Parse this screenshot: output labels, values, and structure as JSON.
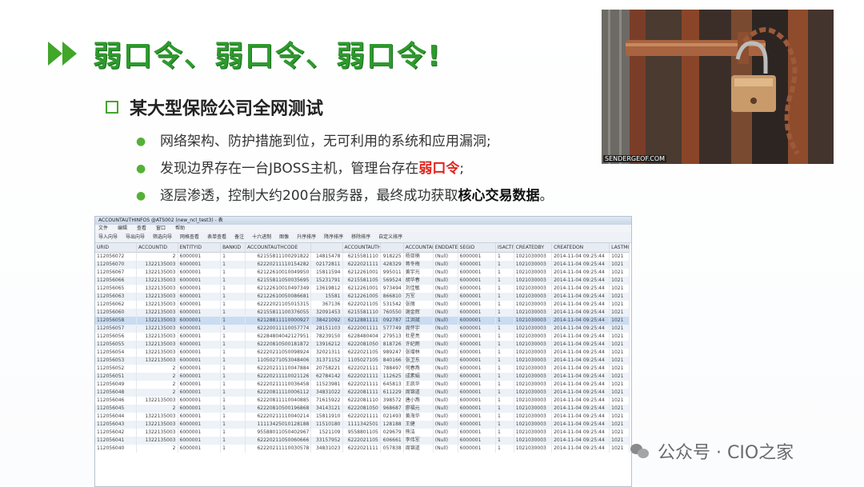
{
  "slide": {
    "title": "弱口令、弱口令、弱口令!",
    "subtitle": "某大型保险公司全网测试",
    "points": [
      {
        "text": "网络架构、防护措施到位，无可利用的系统和应用漏洞;"
      },
      {
        "prefix": "发现边界存在一台JBOSS主机，管理台存在",
        "highlight": "弱口令",
        "suffix": ";"
      },
      {
        "prefix": "逐层渗透，控制大约200台服务器，最终成功获取",
        "highlight": "核心交易数据",
        "suffix": "。"
      }
    ],
    "photo_credit": "SENDERGEOF.COM"
  },
  "db_window": {
    "title": "ACCOUNTAUTHINFOS @ATS002 (new_ncl_test3) - 表",
    "menu": [
      "文件",
      "编辑",
      "查看",
      "窗口",
      "帮助"
    ],
    "toolbar": [
      "导入向导",
      "导出向导",
      "筛选向导",
      "网格查看",
      "表单查看",
      "备注",
      "十六进制",
      "图像",
      "升序排序",
      "降序排序",
      "移除排序",
      "自定义排序"
    ],
    "columns": [
      "URID",
      "ACCOUNTID",
      "ENTITYID",
      "BANKID",
      "ACCOUNTAUTHCODE",
      "ACCOUNTAUTHNUMBER",
      "ACCOUNTAL",
      "ENDDATE",
      "SEGID",
      "ISACTIV",
      "CREATEDBY",
      "CREATEDON",
      "LASTMODIFIED"
    ],
    "rows": [
      [
        "112056072",
        "2",
        "6000001",
        "1",
        "62155811100291822",
        "14815478",
        "6215581110",
        "918225",
        "杨亚楠",
        "(Null)",
        "6000001",
        "1",
        "1021030003",
        "2014-11-04 09:25:44",
        "1021"
      ],
      [
        "112056070",
        "1322135003",
        "6000001",
        "1",
        "62220211110154282",
        "02172811",
        "6222021111",
        "428329",
        "蒋冬梅",
        "(Null)",
        "6000001",
        "1",
        "1021030003",
        "2014-11-04 09:25:44",
        "1021"
      ],
      [
        "112056067",
        "1322135003",
        "6000001",
        "1",
        "62122610010049950",
        "15811594",
        "6212261001",
        "995011",
        "黄宇光",
        "(Null)",
        "6000001",
        "1",
        "1021030003",
        "2014-11-04 09:25:44",
        "1021"
      ],
      [
        "112056066",
        "1322135003",
        "6000001",
        "1",
        "62155811050035695",
        "15231791",
        "6215581105",
        "569524",
        "胡华春",
        "(Null)",
        "6000001",
        "1",
        "1021030003",
        "2014-11-04 09:25:44",
        "1021"
      ],
      [
        "112056065",
        "1322135003",
        "6000001",
        "1",
        "62122610010497349",
        "13619812",
        "6212261001",
        "973494",
        "刘佳敏",
        "(Null)",
        "6000001",
        "1",
        "1021030003",
        "2014-11-04 09:25:44",
        "1021"
      ],
      [
        "112056063",
        "1322135003",
        "6000001",
        "1",
        "62122610050086681",
        "15581",
        "6212261005",
        "866810",
        "万军",
        "(Null)",
        "6000001",
        "1",
        "1021030003",
        "2014-11-04 09:25:44",
        "1021"
      ],
      [
        "112056062",
        "1322135003",
        "6000001",
        "1",
        "62222021105015315",
        "367136",
        "6222021105",
        "531542",
        "张丽",
        "(Null)",
        "6000001",
        "1",
        "1021030003",
        "2014-11-04 09:25:44",
        "1021"
      ],
      [
        "112056060",
        "1322135003",
        "6000001",
        "1",
        "62155811100376055",
        "32091453",
        "6215581110",
        "760550",
        "谢金辉",
        "(Null)",
        "6000001",
        "1",
        "1021030003",
        "2014-11-04 09:25:44",
        "1021"
      ],
      [
        "112056058",
        "1322135003",
        "6000001",
        "1",
        "62128811110000927",
        "38421092",
        "6212881111",
        "092787",
        "江洪斌",
        "(Null)",
        "6000001",
        "1",
        "1021030003",
        "2014-11-04 09:25:44",
        "1021"
      ],
      [
        "112056057",
        "1322135003",
        "6000001",
        "1",
        "62220011110057774",
        "28151103",
        "6222001111",
        "577749",
        "周怀宇",
        "(Null)",
        "6000001",
        "1",
        "1021030003",
        "2014-11-04 09:25:44",
        "1021"
      ],
      [
        "112056056",
        "1322135003",
        "6000001",
        "1",
        "62284804042127951",
        "78239150",
        "6228480404",
        "279513",
        "杜星亮",
        "(Null)",
        "6000001",
        "1",
        "1021030003",
        "2014-11-04 09:25:44",
        "1021"
      ],
      [
        "112056055",
        "1322135003",
        "6000001",
        "1",
        "62220810500181872",
        "13916212",
        "6222081050",
        "818726",
        "许纪雨",
        "(Null)",
        "6000001",
        "1",
        "1021030003",
        "2014-11-04 09:25:44",
        "1021"
      ],
      [
        "112056054",
        "1322135003",
        "6000001",
        "1",
        "62220211050098924",
        "32021311",
        "6222021105",
        "989247",
        "张增林",
        "(Null)",
        "6000001",
        "1",
        "1021030003",
        "2014-11-04 09:25:44",
        "1021"
      ],
      [
        "112056053",
        "1322135003",
        "6000001",
        "1",
        "11050271053048406",
        "31371152",
        "1105027105",
        "840166",
        "张卫东",
        "(Null)",
        "6000001",
        "1",
        "1021030003",
        "2014-11-04 09:25:44",
        "1021"
      ],
      [
        "112056052",
        "2",
        "6000001",
        "1",
        "62220211110047884",
        "20758221",
        "6222021111",
        "788497",
        "何春燕",
        "(Null)",
        "6000001",
        "1",
        "1021030003",
        "2014-11-04 09:25:44",
        "1021"
      ],
      [
        "112056051",
        "2",
        "6000001",
        "1",
        "62220211110021126",
        "62784142",
        "6222021111",
        "112625",
        "成素娟",
        "(Null)",
        "6000001",
        "1",
        "1021030003",
        "2014-11-04 09:25:44",
        "1021"
      ],
      [
        "112056049",
        "2",
        "6000001",
        "1",
        "62220211110036458",
        "11523981",
        "6222021111",
        "645813",
        "王凯华",
        "(Null)",
        "6000001",
        "1",
        "1021030003",
        "2014-11-04 09:25:44",
        "1021"
      ],
      [
        "112056048",
        "2",
        "6000001",
        "1",
        "62220811110006112",
        "34831022",
        "6222081111",
        "611229",
        "周锦道",
        "(Null)",
        "6000001",
        "1",
        "1021030003",
        "2014-11-04 09:25:44",
        "1021"
      ],
      [
        "112056046",
        "1322135003",
        "6000001",
        "1",
        "62220811110040885",
        "71615922",
        "6222081110",
        "398572",
        "唐小燕",
        "(Null)",
        "6000001",
        "1",
        "1021030003",
        "2014-11-04 09:25:44",
        "1021"
      ],
      [
        "112056045",
        "2",
        "6000001",
        "1",
        "62220810500196868",
        "34143121",
        "6222081050",
        "968687",
        "廖福元",
        "(Null)",
        "6000001",
        "1",
        "1021030003",
        "2014-11-04 09:25:44",
        "1021"
      ],
      [
        "112056044",
        "1322135003",
        "6000001",
        "1",
        "62220211110040214",
        "15811910",
        "6222021111",
        "021493",
        "黄海华",
        "(Null)",
        "6000001",
        "1",
        "1021030003",
        "2014-11-04 09:25:44",
        "1021"
      ],
      [
        "112056043",
        "1322135003",
        "6000001",
        "1",
        "11113425010128188",
        "11510180",
        "1111342501",
        "128188",
        "王健",
        "(Null)",
        "6000001",
        "1",
        "1021030003",
        "2014-11-04 09:25:44",
        "1021"
      ],
      [
        "112056042",
        "1322135003",
        "6000001",
        "1",
        "95588011050402967",
        "1521109",
        "9558801105",
        "029679",
        "熊洁",
        "(Null)",
        "6000001",
        "1",
        "1021030003",
        "2014-11-04 09:25:44",
        "1021"
      ],
      [
        "112056041",
        "1322135003",
        "6000001",
        "1",
        "62220211050060666",
        "33157952",
        "6222021105",
        "606661",
        "李伟军",
        "(Null)",
        "6000001",
        "1",
        "1021030003",
        "2014-11-04 09:25:44",
        "1021"
      ],
      [
        "112056040",
        "2",
        "6000001",
        "1",
        "62220211110030578",
        "34831023",
        "6222021111",
        "057838",
        "周锦道",
        "(Null)",
        "6000001",
        "1",
        "1021030003",
        "2014-11-04 09:25:44",
        "1021"
      ]
    ]
  },
  "watermark": "公众号 · CIO之家"
}
